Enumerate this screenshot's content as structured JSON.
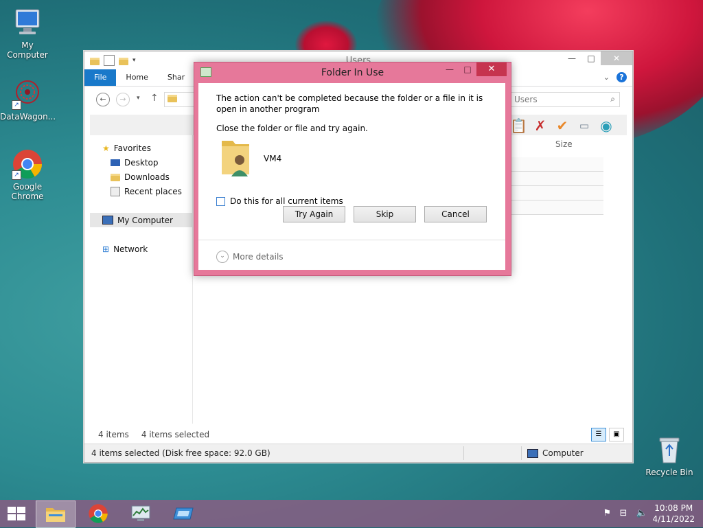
{
  "desktop": {
    "icons": [
      {
        "label": "My Computer"
      },
      {
        "label": "DataWagon..."
      },
      {
        "label": "Google Chrome"
      },
      {
        "label": "Recycle Bin"
      }
    ]
  },
  "explorer": {
    "title": "Users",
    "ribbon_tabs": [
      "File",
      "Home",
      "Shar"
    ],
    "search_placeholder": "Users",
    "nav": {
      "favorites": "Favorites",
      "desktop": "Desktop",
      "downloads": "Downloads",
      "recent": "Recent places",
      "my_computer": "My Computer",
      "network": "Network"
    },
    "column_size": "Size",
    "status_items": "4 items",
    "status_selected": "4 items selected",
    "statusbar_left": "4 items selected (Disk free space: 92.0 GB)",
    "statusbar_right": "Computer"
  },
  "dialog": {
    "title": "Folder In Use",
    "message": "The action can't be completed because the folder or a file in it is open in another program",
    "instruction": "Close the folder or file and try again.",
    "item_name": "VM4",
    "checkbox_label": "Do this for all current items",
    "checkbox_checked": false,
    "buttons": {
      "try_again": "Try Again",
      "skip": "Skip",
      "cancel": "Cancel"
    },
    "more_details": "More details"
  },
  "taskbar": {
    "time": "10:08 PM",
    "date": "4/11/2022"
  },
  "colors": {
    "dialog_frame": "#e6789a",
    "file_tab": "#1979ca",
    "taskbar": "#915a82"
  }
}
